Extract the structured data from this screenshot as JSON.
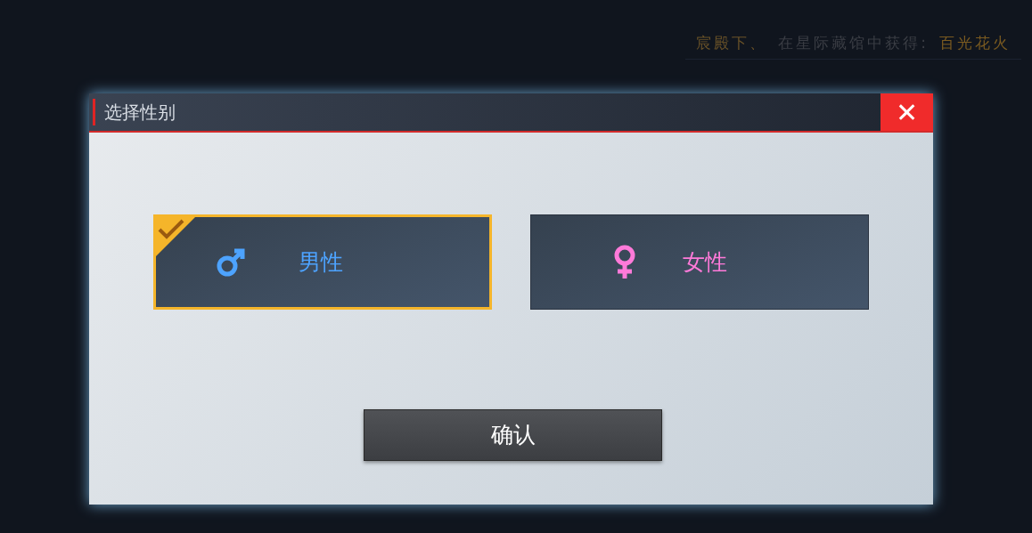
{
  "notice": [
    {
      "text": "宸殿下、",
      "color": "#6a5228"
    },
    {
      "text": "在星际藏馆中获得:",
      "color": "#3a3d44"
    },
    {
      "text": "百光花火",
      "color": "#7a5a20"
    }
  ],
  "dialog": {
    "title": "选择性别",
    "close": "✕",
    "options": [
      {
        "kind": "male",
        "label": "男性",
        "selected": true
      },
      {
        "kind": "female",
        "label": "女性",
        "selected": false
      }
    ],
    "confirm": "确认"
  }
}
